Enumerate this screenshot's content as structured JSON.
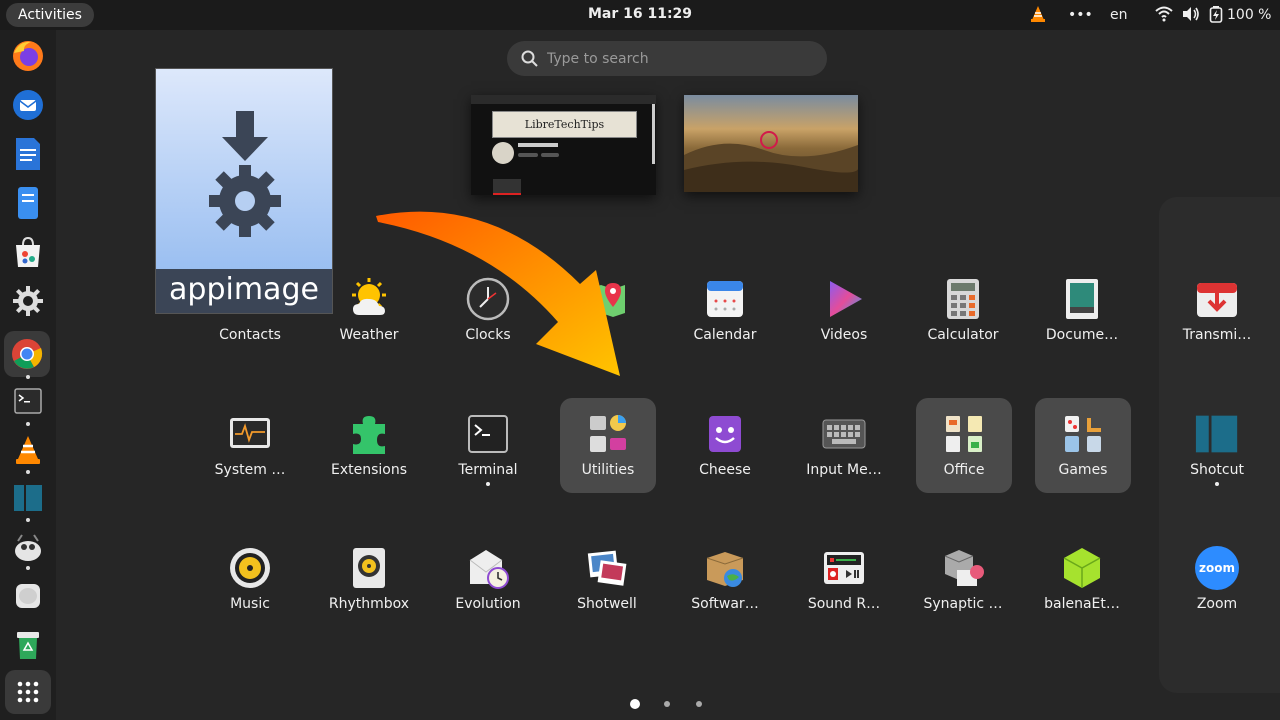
{
  "topbar": {
    "activities_label": "Activities",
    "datetime": "Mar 16  11:29",
    "overflow_label": "•••",
    "keyboard_layout": "en",
    "battery_percent": "100 %",
    "icons": [
      "vlc-tray-icon",
      "wifi-icon",
      "volume-icon",
      "battery-icon"
    ]
  },
  "search": {
    "placeholder": "Type to search",
    "value": ""
  },
  "workspaces": [
    {
      "name": "workspace-1",
      "channel_name": "LibreTechTips"
    },
    {
      "name": "workspace-2"
    }
  ],
  "dock": {
    "items": [
      {
        "name": "firefox",
        "running": false
      },
      {
        "name": "thunderbird",
        "running": false
      },
      {
        "name": "libreoffice-writer",
        "running": false
      },
      {
        "name": "files",
        "running": false
      },
      {
        "name": "software",
        "running": false
      },
      {
        "name": "settings",
        "running": false
      },
      {
        "name": "chrome",
        "running": true,
        "active": true
      },
      {
        "name": "terminal",
        "running": true
      },
      {
        "name": "vlc",
        "running": true
      },
      {
        "name": "shotcut",
        "running": true
      },
      {
        "name": "gimp",
        "running": true
      },
      {
        "name": "drive",
        "running": false
      },
      {
        "name": "trash",
        "running": false
      },
      {
        "name": "show-apps",
        "running": false
      }
    ]
  },
  "apps": {
    "row1": [
      {
        "label": "Contacts"
      },
      {
        "label": "Weather"
      },
      {
        "label": "Clocks"
      },
      {
        "label": "Maps"
      },
      {
        "label": "Calendar"
      },
      {
        "label": "Videos"
      },
      {
        "label": "Calculator"
      },
      {
        "label": "Docume…"
      }
    ],
    "row2": [
      {
        "label": "System …"
      },
      {
        "label": "Extensions"
      },
      {
        "label": "Terminal",
        "running": true
      },
      {
        "label": "Utilities",
        "folder": true
      },
      {
        "label": "Cheese"
      },
      {
        "label": "Input Me…"
      },
      {
        "label": "Office",
        "folder": true
      },
      {
        "label": "Games",
        "folder": true
      }
    ],
    "row3": [
      {
        "label": "Music"
      },
      {
        "label": "Rhythmbox"
      },
      {
        "label": "Evolution"
      },
      {
        "label": "Shotwell"
      },
      {
        "label": "Softwar…"
      },
      {
        "label": "Sound R…"
      },
      {
        "label": "Synaptic …"
      },
      {
        "label": "balenaEt…"
      }
    ],
    "next_page": [
      {
        "label": "Transmi…"
      },
      {
        "label": "Shotcut",
        "running": true
      },
      {
        "label": "Zoom",
        "icon_text": "zoom"
      }
    ]
  },
  "pagination": {
    "pages": 3,
    "current": 1
  },
  "overlay": {
    "appimage_label": "appimage"
  },
  "colors": {
    "accent": "#4a86e8",
    "arrow_start": "#ff5a00",
    "arrow_end": "#ffc400",
    "folder_bg": "#4a4a4a"
  }
}
